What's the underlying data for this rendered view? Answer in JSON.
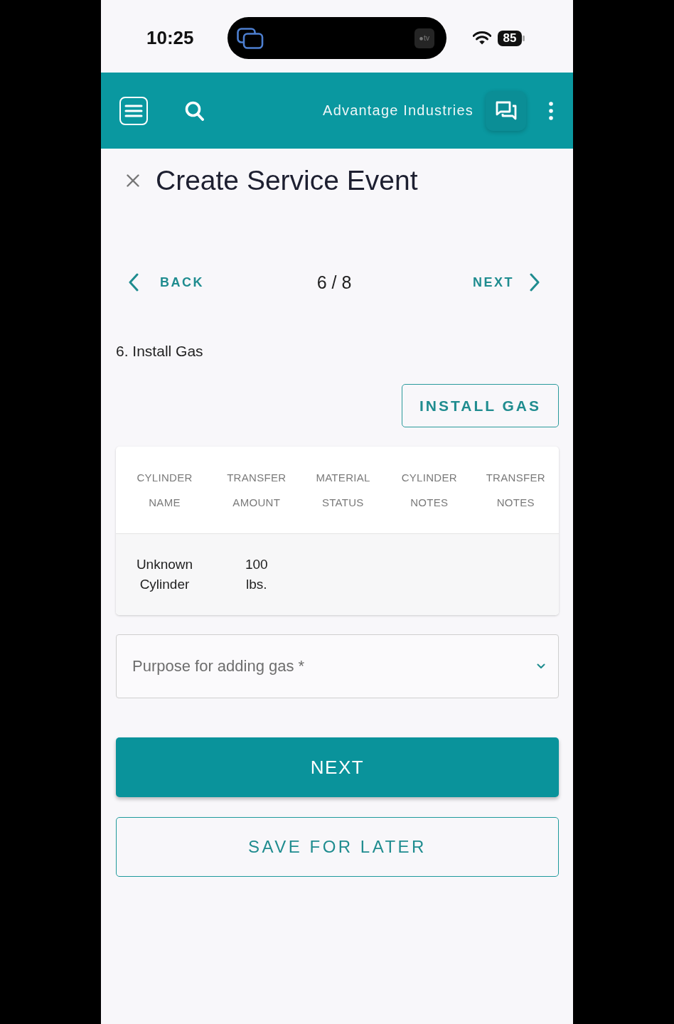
{
  "status_bar": {
    "time": "10:25",
    "island_badge": "tv",
    "battery": "85"
  },
  "app_bar": {
    "company": "Advantage Industries"
  },
  "header": {
    "title": "Create Service Event"
  },
  "step_nav": {
    "back": "BACK",
    "counter": "6 / 8",
    "next": "NEXT"
  },
  "step": {
    "title": "6. Install Gas",
    "action": "INSTALL GAS"
  },
  "table": {
    "columns": [
      "CYLINDER NAME",
      "TRANSFER AMOUNT",
      "MATERIAL STATUS",
      "CYLINDER NOTES",
      "TRANSFER NOTES"
    ],
    "rows": [
      {
        "cells": [
          "Unknown Cylinder",
          "100 lbs."
        ]
      }
    ]
  },
  "purpose_field": {
    "placeholder": "Purpose for adding gas *"
  },
  "buttons": [
    {
      "label": "NEXT",
      "kind": "primary"
    },
    {
      "label": "SAVE FOR LATER",
      "kind": "outlined"
    }
  ]
}
